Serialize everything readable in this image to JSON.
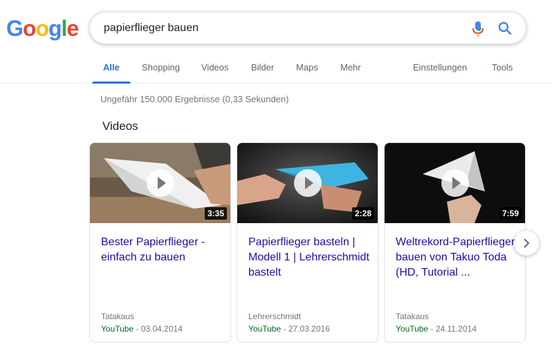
{
  "logo": {
    "letters": [
      {
        "char": "G",
        "color": "#4285f4"
      },
      {
        "char": "o",
        "color": "#ea4335"
      },
      {
        "char": "o",
        "color": "#fbbc05"
      },
      {
        "char": "g",
        "color": "#4285f4"
      },
      {
        "char": "l",
        "color": "#34a853"
      },
      {
        "char": "e",
        "color": "#ea4335"
      }
    ]
  },
  "search": {
    "query": "papierflieger bauen",
    "mic_icon": "microphone-icon",
    "search_icon": "magnifier-icon"
  },
  "tabs": {
    "items": [
      {
        "label": "Alle",
        "active": true
      },
      {
        "label": "Shopping"
      },
      {
        "label": "Videos"
      },
      {
        "label": "Bilder"
      },
      {
        "label": "Maps"
      },
      {
        "label": "Mehr"
      }
    ],
    "settings": "Einstellungen",
    "tools": "Tools",
    "accent_color": "#1a73e8"
  },
  "results": {
    "stats": "Ungefähr 150.000 Ergebnisse (0,33 Sekunden)"
  },
  "videos": {
    "heading": "Videos",
    "cards": [
      {
        "duration": "3:35",
        "title": "Bester Papierflieger - einfach zu bauen",
        "channel": "Tatakaus",
        "source": "YouTube",
        "date": " - 03.04.2014"
      },
      {
        "duration": "2:28",
        "title": "Papierflieger basteln | Modell 1 | Lehrerschmidt bastelt",
        "channel": "Lehrerschmidt",
        "source": "YouTube",
        "date": " - 27.03.2016"
      },
      {
        "duration": "7:59",
        "title": "Weltrekord-Papierflieger bauen von Takuo Toda (HD, Tutorial ...",
        "channel": "Tatakaus",
        "source": "YouTube",
        "date": " - 24.11.2014"
      }
    ],
    "next_icon": "chevron-right-icon"
  }
}
